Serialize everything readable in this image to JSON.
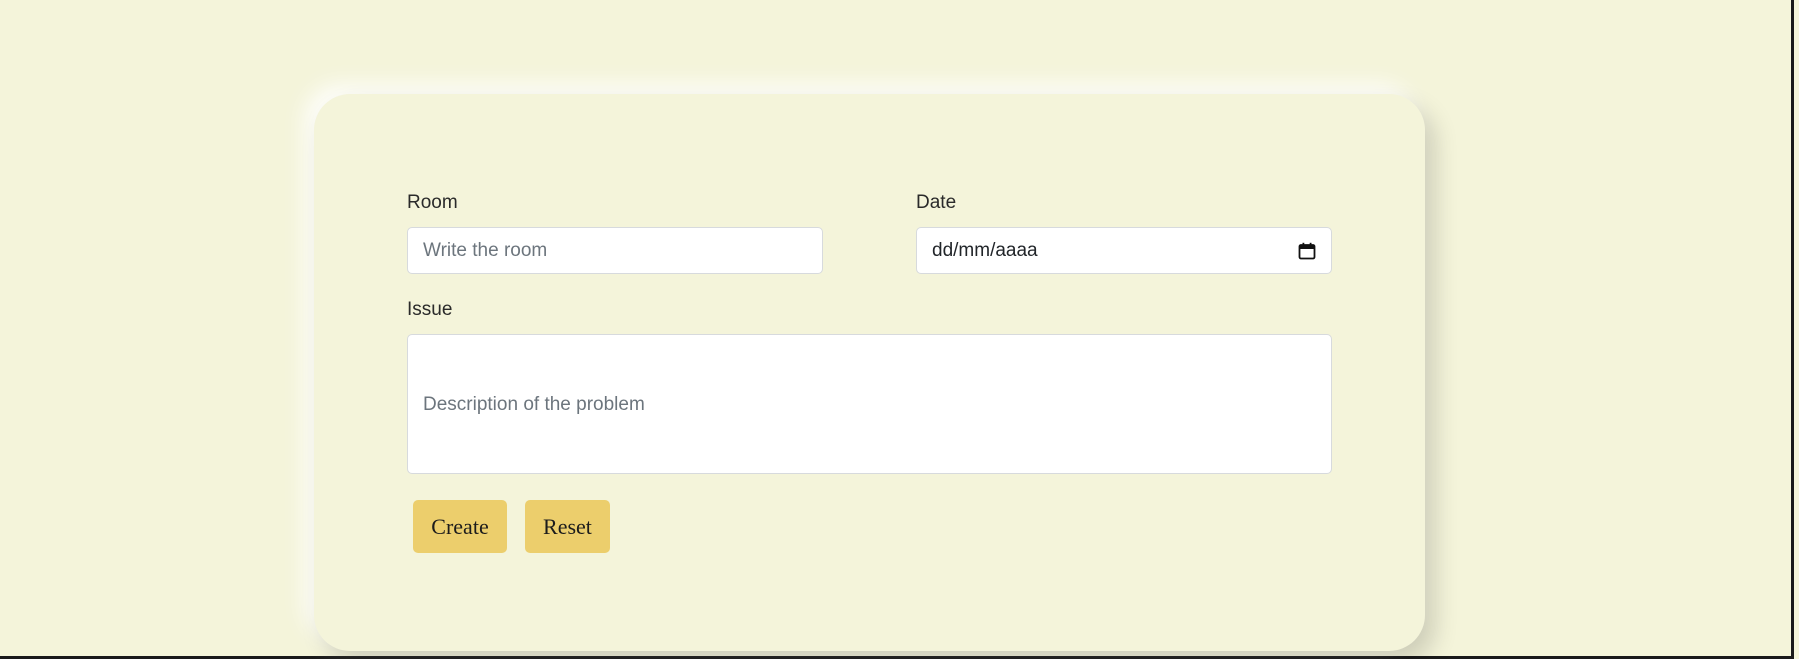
{
  "form": {
    "room": {
      "label": "Room",
      "placeholder": "Write the room",
      "value": ""
    },
    "date": {
      "label": "Date",
      "format_placeholder": "dd/mm/aaaa",
      "icon": "calendar-icon"
    },
    "issue": {
      "label": "Issue",
      "placeholder": "Description of the problem",
      "value": ""
    },
    "buttons": {
      "create_label": "Create",
      "reset_label": "Reset"
    }
  },
  "colors": {
    "page_background": "#f4f4da",
    "card_background": "#f4f4da",
    "button_background": "#ecce6c",
    "input_background": "#ffffff",
    "input_border": "#d7dadd"
  }
}
